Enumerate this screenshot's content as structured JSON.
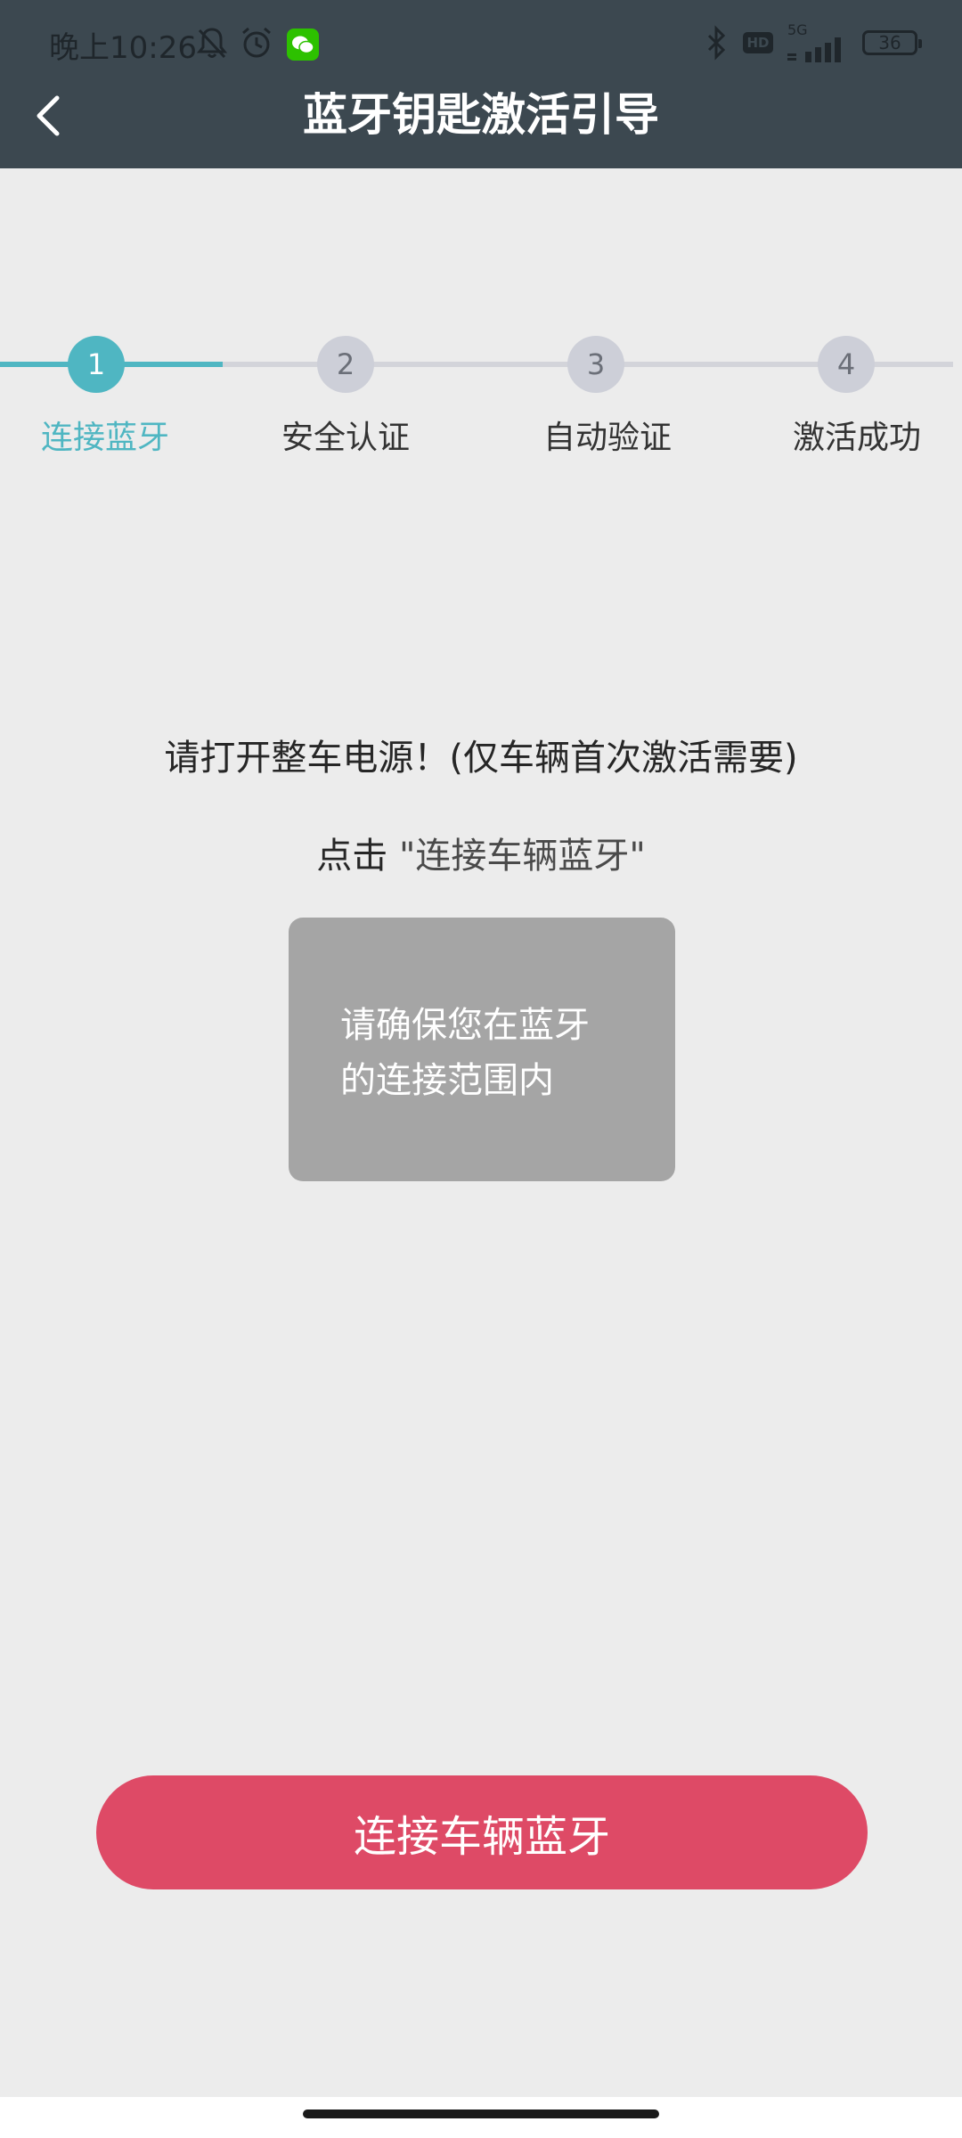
{
  "status_bar": {
    "time": "晚上10:26",
    "network": "5G",
    "hd": "HD",
    "battery": "36",
    "icons": [
      "bell-off-icon",
      "alarm-icon",
      "wechat-icon",
      "bluetooth-icon",
      "hd-icon",
      "signal-icon",
      "battery-icon"
    ]
  },
  "nav": {
    "title": "蓝牙钥匙激活引导",
    "back_icon": "chevron-left-icon"
  },
  "stepper": {
    "active_step": 1,
    "steps": [
      {
        "number": "1",
        "label": "连接蓝牙"
      },
      {
        "number": "2",
        "label": "安全认证"
      },
      {
        "number": "3",
        "label": "自动验证"
      },
      {
        "number": "4",
        "label": "激活成功"
      }
    ]
  },
  "instructions": {
    "power_on": "请打开整车电源！(仅车辆首次激活需要)",
    "click_prefix": "点击 ",
    "click_quote": "\"连接车辆蓝牙\""
  },
  "tip": {
    "line1": "请确保您在蓝牙",
    "line2": "的连接范围内"
  },
  "connect_button": {
    "label": "连接车辆蓝牙"
  },
  "colors": {
    "header_bg": "#3c4850",
    "accent": "#4fb6c2",
    "button": "#de4a66",
    "page_bg": "#ececec",
    "tip_bg": "#a5a5a5"
  }
}
